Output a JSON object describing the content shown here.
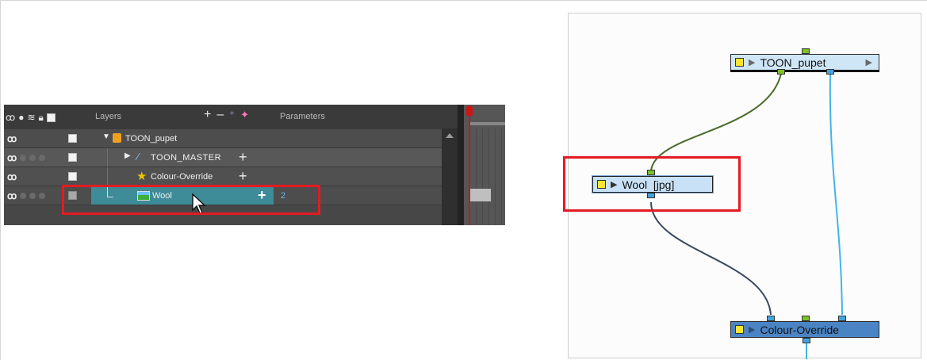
{
  "timeline": {
    "header": {
      "layers_label": "Layers",
      "parameters_label": "Parameters",
      "tool_add": "+",
      "tool_remove": "–",
      "tool_peg": "⁺",
      "tool_effect": "✦"
    },
    "layers": [
      {
        "name": "TOON_pupet",
        "icon": "group-icon",
        "expanded": true
      },
      {
        "name": "TOON_MASTER",
        "icon": "drawing-icon",
        "add": "+"
      },
      {
        "name": "Colour-Override",
        "icon": "star-icon",
        "add": "+"
      },
      {
        "name": "Wool",
        "icon": "image-icon",
        "add": "+",
        "count": "2",
        "selected": true
      }
    ],
    "glyph_cc": "ꝏ"
  },
  "nodeview": {
    "nodes": {
      "toon_pupet": {
        "label": "TOON_pupet"
      },
      "wool": {
        "label": "Wool  [jpg]"
      },
      "colour_override": {
        "label": "Colour-Override"
      }
    }
  },
  "colors": {
    "highlight_box": "#e31b23",
    "wool_row": "#3d8c97",
    "group_node": "#cfe6f7",
    "effect_node": "#4b84c4",
    "green_cable": "#4b6b2a",
    "dark_cable": "#3a4a5c",
    "blue_cable": "#44b4e6"
  }
}
